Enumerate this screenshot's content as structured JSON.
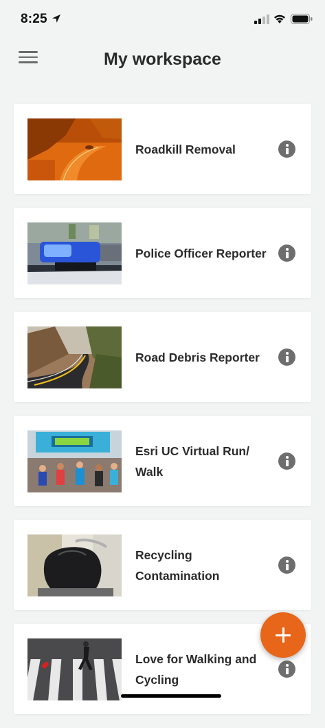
{
  "status": {
    "time": "8:25"
  },
  "header": {
    "title": "My workspace"
  },
  "surveys": [
    {
      "title": "Roadkill Removal",
      "image": "roadkill-photo"
    },
    {
      "title": "Police Officer Reporter",
      "image": "police-light-photo"
    },
    {
      "title": "Road Debris Reporter",
      "image": "road-photo"
    },
    {
      "title": "Esri UC Virtual Run/ Walk",
      "image": "run-start-photo"
    },
    {
      "title": "Recycling Contamination",
      "image": "recycling-bag-photo"
    },
    {
      "title": "Love for Walking and Cycling",
      "image": "crosswalk-photo"
    }
  ],
  "colors": {
    "accent": "#e8661a",
    "background": "#f2f3f3",
    "info": "#6e6e6e"
  },
  "icons": {
    "menu": "hamburger-menu-icon",
    "info": "info-icon",
    "add": "plus-icon"
  }
}
